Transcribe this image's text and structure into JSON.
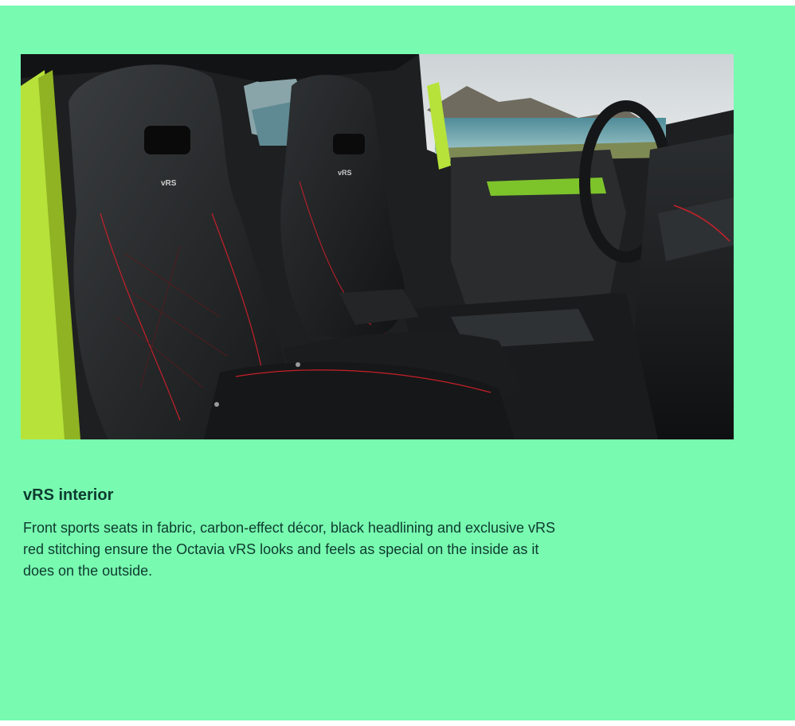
{
  "feature": {
    "title": "vRS interior",
    "description": "Front sports seats in fabric, carbon-effect décor, black headlining and exclusive vRS red stitching ensure the Octavia vRS looks and feels as special on the inside as it does on the outside.",
    "image": {
      "seat_badge_text": "vRS"
    }
  },
  "colors": {
    "background": "#78fab0",
    "text": "#0e3a2f",
    "car_body": "#b6e23a",
    "stitching": "#c8202a"
  }
}
